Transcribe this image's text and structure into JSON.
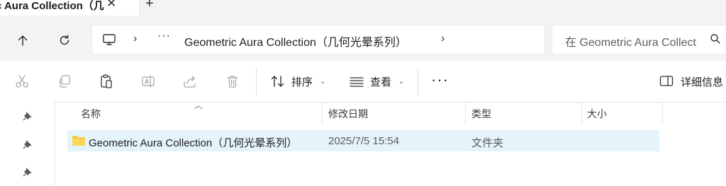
{
  "tab": {
    "title": "c Aura Collection（几",
    "close_label": "✕",
    "new_tab_label": "+"
  },
  "nav": {
    "breadcrumb_more": "···",
    "breadcrumb_chevron": "›",
    "folder_path": "Geometric Aura Collection（几何光晕系列）",
    "search_placeholder": "在 Geometric Aura Collection（几何光晕系列）中搜索"
  },
  "toolbar": {
    "sort_label": "排序",
    "view_label": "查看",
    "more_label": "···",
    "details_label": "详细信息"
  },
  "columns": {
    "name": "名称",
    "date": "修改日期",
    "type": "类型",
    "size": "大小"
  },
  "files": [
    {
      "name": "Geometric Aura Collection（几何光晕系列）",
      "date": "2025/7/5 15:54",
      "type": "文件夹",
      "size": ""
    }
  ],
  "colors": {
    "selection": "#e5f3fb",
    "folder": "#f8c93e",
    "chrome": "#f3f3f3"
  }
}
